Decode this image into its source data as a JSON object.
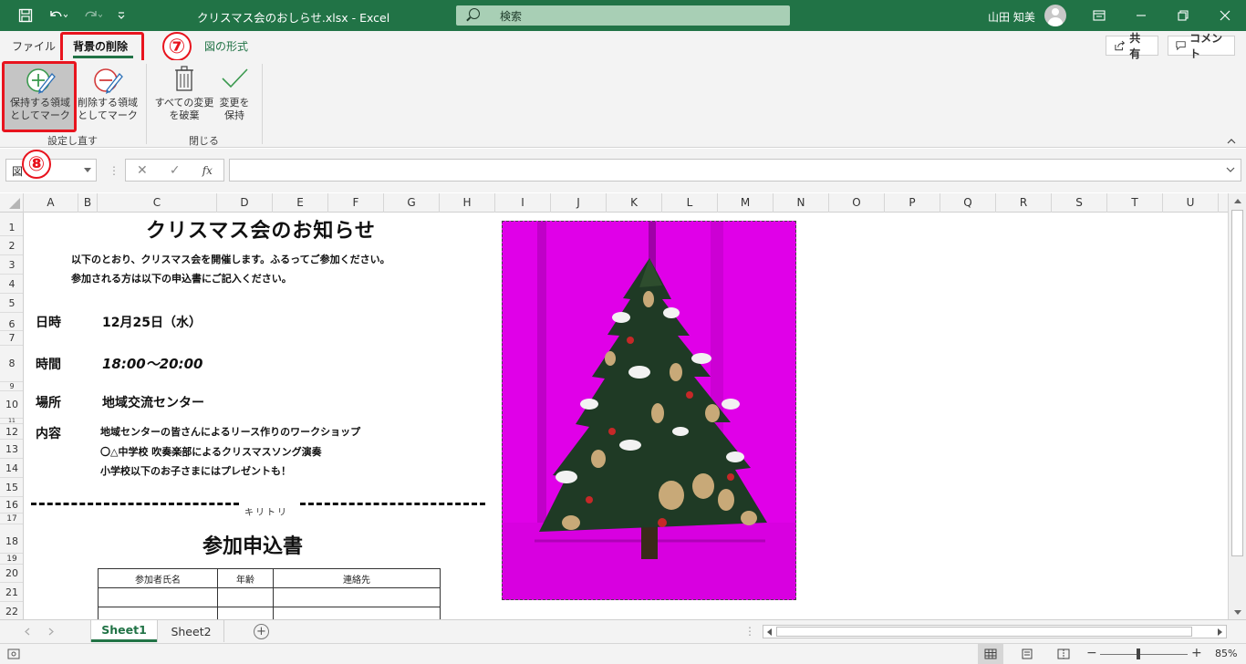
{
  "titlebar": {
    "document_title": "クリスマス会のおしらせ.xlsx  -  Excel",
    "search_placeholder": "検索",
    "user_name": "山田 知美",
    "save_icon": "save-icon",
    "undo_icon": "undo-icon",
    "redo_icon": "redo-icon",
    "customize_icon": "customize-qat-icon",
    "ribbon_display_icon": "ribbon-display-options-icon",
    "minimize_icon": "minimize-icon",
    "restore_icon": "restore-icon",
    "close_icon": "close-icon",
    "accent_color": "#217346"
  },
  "tabs": {
    "file": "ファイル",
    "background_removal": "背景の削除",
    "picture_format": "図の形式",
    "share_label": "共有",
    "comment_label": "コメント"
  },
  "ribbon": {
    "keep_label_1": "保持する領域",
    "keep_label_2": "としてマーク",
    "remove_label_1": "削除する領域",
    "remove_label_2": "としてマーク",
    "group_refine": "設定し直す",
    "discard_label_1": "すべての変更",
    "discard_label_2": "を破棄",
    "keep_changes_label_1": "変更を",
    "keep_changes_label_2": "保持",
    "group_close": "閉じる"
  },
  "annotations": {
    "step7": "⑦",
    "step8": "⑧",
    "highlight_color": "#e8141e"
  },
  "formula_bar": {
    "name_box": "図",
    "cancel": "✕",
    "enter": "✓",
    "fx": "fx",
    "formula": ""
  },
  "columns": [
    "A",
    "B",
    "C",
    "D",
    "E",
    "F",
    "G",
    "H",
    "I",
    "J",
    "K",
    "L",
    "M",
    "N",
    "O",
    "P",
    "Q",
    "R",
    "S",
    "T",
    "U"
  ],
  "rows": [
    "1",
    "2",
    "3",
    "4",
    "5",
    "6",
    "7",
    "8",
    "9",
    "10",
    "11",
    "12",
    "13",
    "14",
    "15",
    "16",
    "17",
    "18",
    "19",
    "20",
    "21",
    "22"
  ],
  "sheet": {
    "title": "クリスマス会のお知らせ",
    "intro_1": "以下のとおり、クリスマス会を開催します。ふるってご参加ください。",
    "intro_2": "参加される方は以下の申込書にご記入ください。",
    "date_label": "日時",
    "date_value": "12月25日（水）",
    "time_label": "時間",
    "time_value": "18:00～20:00",
    "place_label": "場所",
    "place_value": "地域交流センター",
    "content_label": "内容",
    "content_1": "地域センターの皆さんによるリース作りのワークショップ",
    "content_2": "〇△中学校 吹奏楽部によるクリスマスソング演奏",
    "content_3": "小学校以下のお子さまにはプレゼントも！",
    "cut_line": "キリトリ",
    "form_title": "参加申込書",
    "form_headers": [
      "参加者氏名",
      "年齢",
      "連絡先"
    ],
    "picture_removal_color": "#e000e8"
  },
  "sheet_tabs": [
    "Sheet1",
    "Sheet2"
  ],
  "status": {
    "zoom": "85%"
  }
}
